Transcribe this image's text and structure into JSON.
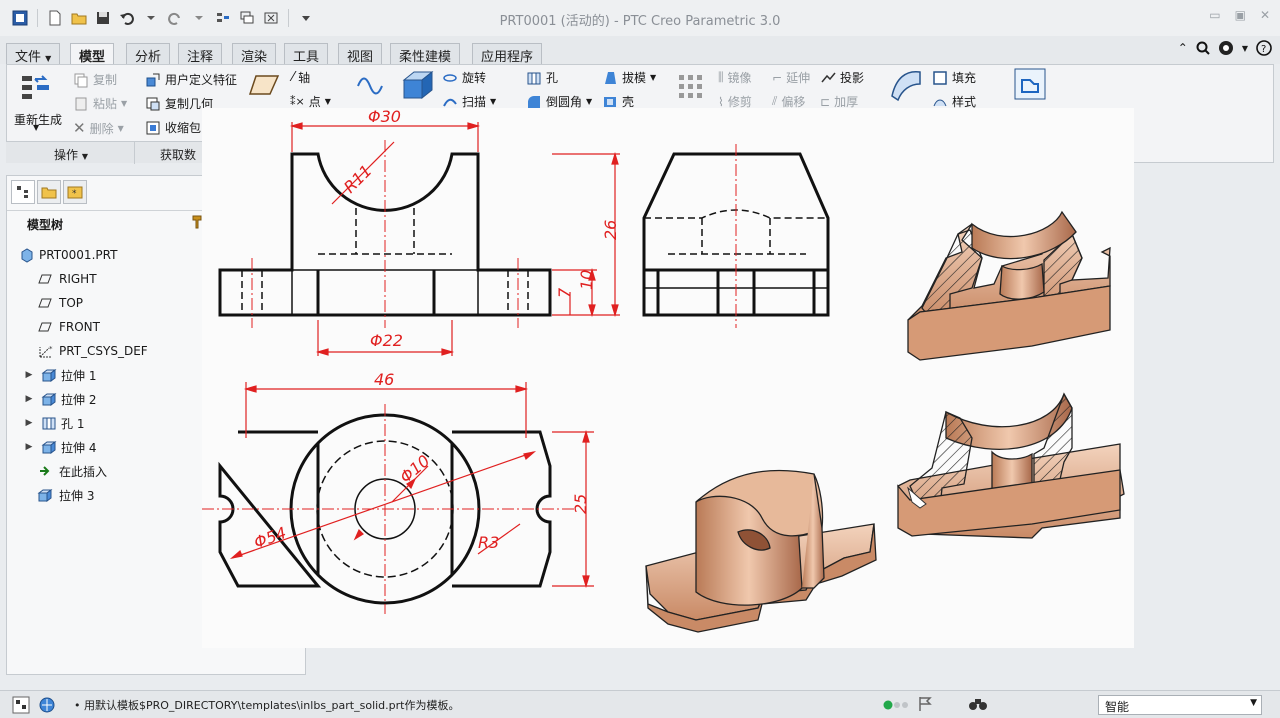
{
  "window": {
    "title": "PRT0001 (活动的) - PTC Creo Parametric 3.0"
  },
  "tabs": [
    {
      "label": "文件",
      "has_dropdown": true
    },
    {
      "label": "模型",
      "active": true
    },
    {
      "label": "分析"
    },
    {
      "label": "注释"
    },
    {
      "label": "渲染"
    },
    {
      "label": "工具"
    },
    {
      "label": "视图"
    },
    {
      "label": "柔性建模"
    },
    {
      "label": "应用程序"
    }
  ],
  "ribbon": {
    "regenerate": "重新生成",
    "copy": "复制",
    "paste": "粘贴",
    "delete": "删除",
    "user_feature": "用户定义特征",
    "copy_geometry": "复制几何",
    "shrinkwrap": "收缩包",
    "axis": "轴",
    "point": "点",
    "revolve": "旋转",
    "sweep": "扫描",
    "hole": "孔",
    "round": "倒圆角",
    "draft": "拔模",
    "shell": "壳",
    "mirror": "镜像",
    "extend": "延伸",
    "project": "投影",
    "trim": "修剪",
    "offset": "偏移",
    "thicken": "加厚",
    "fill": "填充",
    "style": "样式",
    "group_operations": "操作",
    "group_get_data": "获取数"
  },
  "model_tree": {
    "title": "模型树",
    "items": [
      {
        "label": "PRT0001.PRT",
        "icon": "part-icon"
      },
      {
        "label": "RIGHT",
        "icon": "datum-plane-icon"
      },
      {
        "label": "TOP",
        "icon": "datum-plane-icon"
      },
      {
        "label": "FRONT",
        "icon": "datum-plane-icon"
      },
      {
        "label": "PRT_CSYS_DEF",
        "icon": "csys-icon"
      },
      {
        "label": "拉伸 1",
        "icon": "extrude-icon",
        "expandable": true
      },
      {
        "label": "拉伸 2",
        "icon": "extrude-icon",
        "expandable": true
      },
      {
        "label": "孔 1",
        "icon": "hole-icon",
        "expandable": true
      },
      {
        "label": "拉伸 4",
        "icon": "extrude-icon",
        "expandable": true
      },
      {
        "label": "在此插入",
        "icon": "insert-arrow-icon"
      },
      {
        "label": "拉伸 3",
        "icon": "extrude-icon"
      }
    ]
  },
  "drawing": {
    "dim_phi30": "Φ30",
    "dim_r11": "R11",
    "dim_26": "26",
    "dim_10": "10",
    "dim_7": "7",
    "dim_phi22": "Φ22",
    "dim_46": "46",
    "dim_phi10": "Φ10",
    "dim_phi54": "Φ54",
    "dim_r3": "R3",
    "dim_25": "25"
  },
  "status": {
    "message": "用默认模板$PRO_DIRECTORY\\templates\\inlbs_part_solid.prt作为模板。",
    "filter": "智能"
  },
  "colors": {
    "dimension_red": "#e02020",
    "part_copper": "#d9a07e",
    "ribbon_bg": "#f3f4f6"
  }
}
